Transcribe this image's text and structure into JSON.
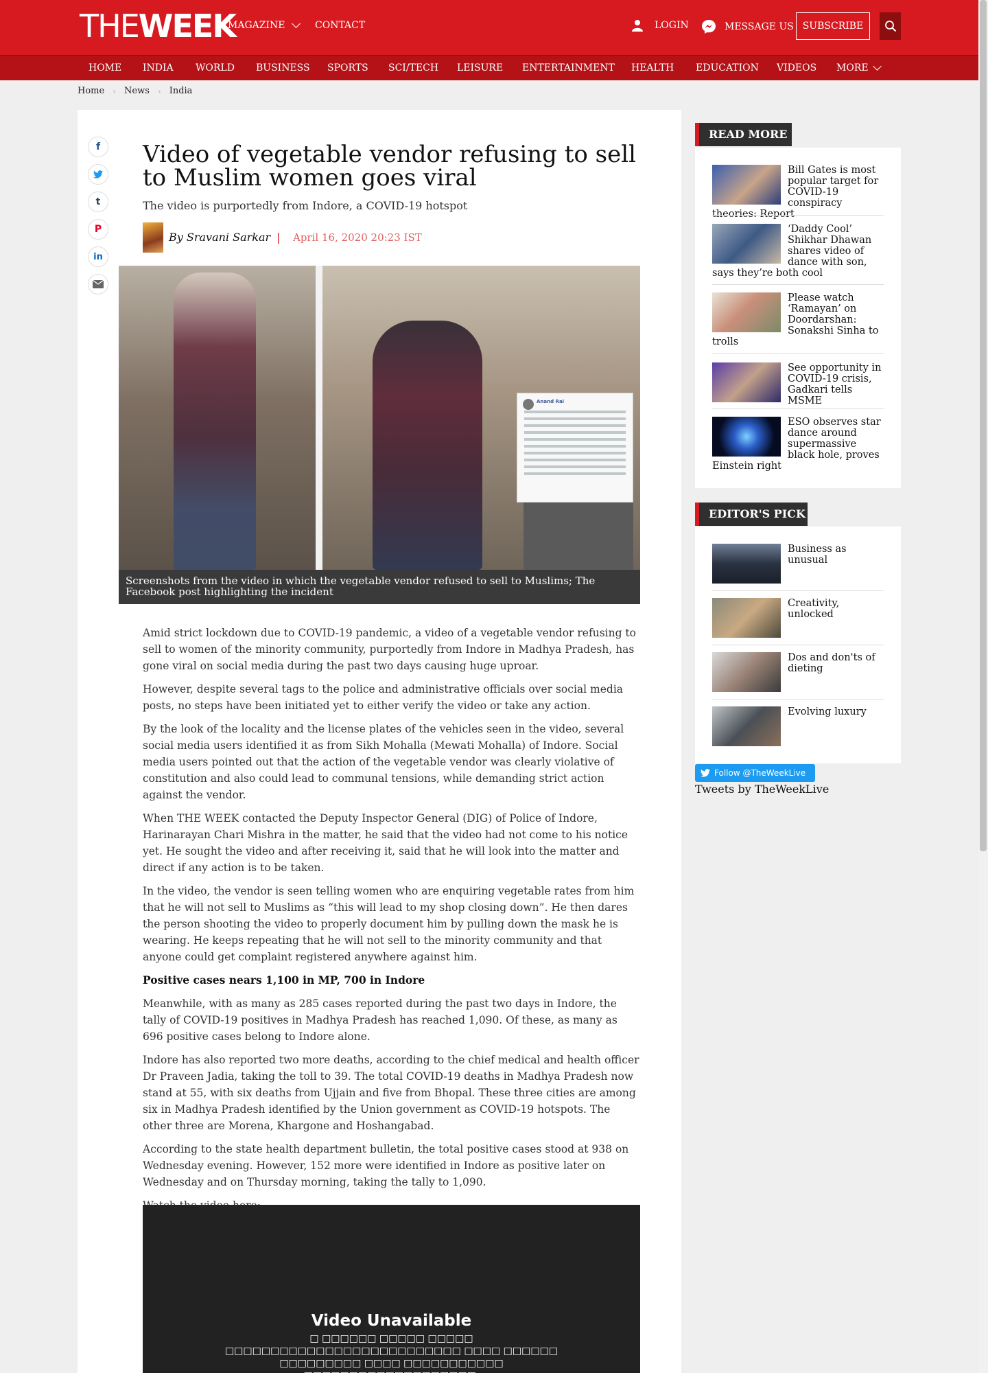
{
  "header": {
    "logo_the": "THE",
    "logo_week": "WEEK",
    "magazine": "MAGAZINE",
    "contact": "CONTACT",
    "login": "LOGIN",
    "message_us": "MESSAGE US",
    "subscribe": "SUBSCRIBE"
  },
  "nav": [
    "HOME",
    "INDIA",
    "WORLD",
    "BUSINESS",
    "SPORTS",
    "SCI/TECH",
    "LEISURE",
    "ENTERTAINMENT",
    "HEALTH",
    "EDUCATION",
    "VIDEOS",
    "MORE"
  ],
  "breadcrumb": [
    "Home",
    "News",
    "India"
  ],
  "article": {
    "title": "Video of vegetable vendor refusing to sell to Muslim women goes viral",
    "subtitle": "The video is purportedly from Indore, a COVID-19 hotspot",
    "author": "By Sravani Sarkar",
    "separator": "|",
    "date": "April 16, 2020 20:23 IST",
    "caption": "Screenshots from the video in which the vegetable vendor refused to sell to Muslims; The Facebook post highlighting the incident",
    "image_post_name": "Anand Rai",
    "paragraphs": [
      "Amid strict lockdown due to COVID-19 pandemic, a video of a vegetable vendor refusing to sell to women of the minority community, purportedly from Indore in Madhya Pradesh, has gone viral on social media during the past two days causing huge uproar.",
      "However, despite several tags to the police and administrative officials over social media posts, no steps have been initiated yet to either verify the video or take any action.",
      "By the look of the locality and the license plates of the vehicles seen in the video, several social media users identified it as from Sikh Mohalla (Mewati Mohalla) of Indore. Social media users pointed out that the action of the vegetable vendor was clearly violative of constitution and also could lead to communal tensions, while demanding strict action against the vendor.",
      "When THE WEEK contacted the Deputy Inspector General (DIG) of Police of Indore, Harinarayan Chari Mishra in the matter, he said that the video had not come to his notice yet. He sought the video and after receiving it, said that he will look into the matter and direct if any action is to be taken.",
      "In the video, the vendor is seen telling women who are enquiring vegetable rates from him that he will not sell to Muslims as “this will lead to my shop closing down”. He then dares the person shooting the video to properly document him by pulling down the mask he is wearing. He keeps repeating that he will not sell to the minority community and that anyone could get complaint registered anywhere against him."
    ],
    "subheading": "Positive cases nears 1,100 in MP, 700 in Indore",
    "paragraphs2": [
      "Meanwhile, with as many as 285 cases reported during the past two days in Indore, the tally of COVID-19 positives in Madhya Pradesh has reached 1,090. Of these, as many as 696 positive cases belong to Indore alone.",
      "Indore has also reported two more deaths, according to the chief medical and health officer Dr Praveen Jadia, taking the toll to 39. The total COVID-19 deaths in Madhya Pradesh now stand at 55, with six deaths from Ujjain and five from Bhopal. These three cities are among six in Madhya Pradesh identified by the Union government as COVID-19 hotspots. The other three are Morena, Khargone and Hoshangabad.",
      "According to the state health department bulletin, the total positive cases stood at 938 on Wednesday evening. However, 152 more were identified in Indore as positive later on Wednesday and on Thursday morning, taking the tally to 1,090.",
      "Watch the video here:"
    ],
    "video_title": "Video Unavailable"
  },
  "sidebar": {
    "read_more_title": "READ MORE",
    "read_more": [
      "Bill Gates is most popular target for COVID-19 conspiracy theories: Report",
      "‘Daddy Cool’ Shikhar Dhawan shares video of dance with son, says they’re both cool",
      "Please watch ‘Ramayan’ on Doordarshan: Sonakshi Sinha to trolls",
      "See opportunity in COVID-19 crisis, Gadkari tells MSME",
      "ESO observes star dance around supermassive black hole, proves Einstein right"
    ],
    "editors_pick_title": "EDITOR'S PICK",
    "editors_pick": [
      "Business as unusual",
      "Creativity, unlocked",
      "Dos and don'ts of dieting",
      "Evolving luxury"
    ],
    "follow": "Follow @TheWeekLive",
    "tweets_by": "Tweets by TheWeekLive"
  },
  "colors": {
    "brand_red": "#d71920",
    "nav_red": "#b41217",
    "date_red": "#e06060",
    "sidebar_head": "#2f2f2f",
    "twitter_blue": "#1d9bf0"
  }
}
